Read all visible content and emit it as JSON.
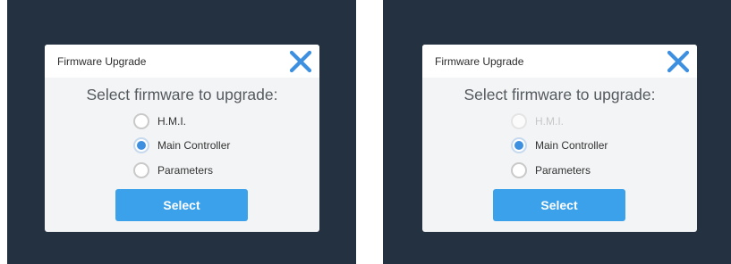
{
  "accent_color": "#3aa1ea",
  "panels": [
    {
      "title": "Firmware Upgrade",
      "close_icon": "close-icon",
      "prompt": "Select firmware to upgrade:",
      "options": [
        {
          "label": "H.M.I.",
          "selected": false,
          "disabled": false
        },
        {
          "label": "Main Controller",
          "selected": true,
          "disabled": false
        },
        {
          "label": "Parameters",
          "selected": false,
          "disabled": false
        }
      ],
      "button_label": "Select"
    },
    {
      "title": "Firmware Upgrade",
      "close_icon": "close-icon",
      "prompt": "Select firmware to upgrade:",
      "options": [
        {
          "label": "H.M.I.",
          "selected": false,
          "disabled": true
        },
        {
          "label": "Main Controller",
          "selected": true,
          "disabled": false
        },
        {
          "label": "Parameters",
          "selected": false,
          "disabled": false
        }
      ],
      "button_label": "Select"
    }
  ]
}
